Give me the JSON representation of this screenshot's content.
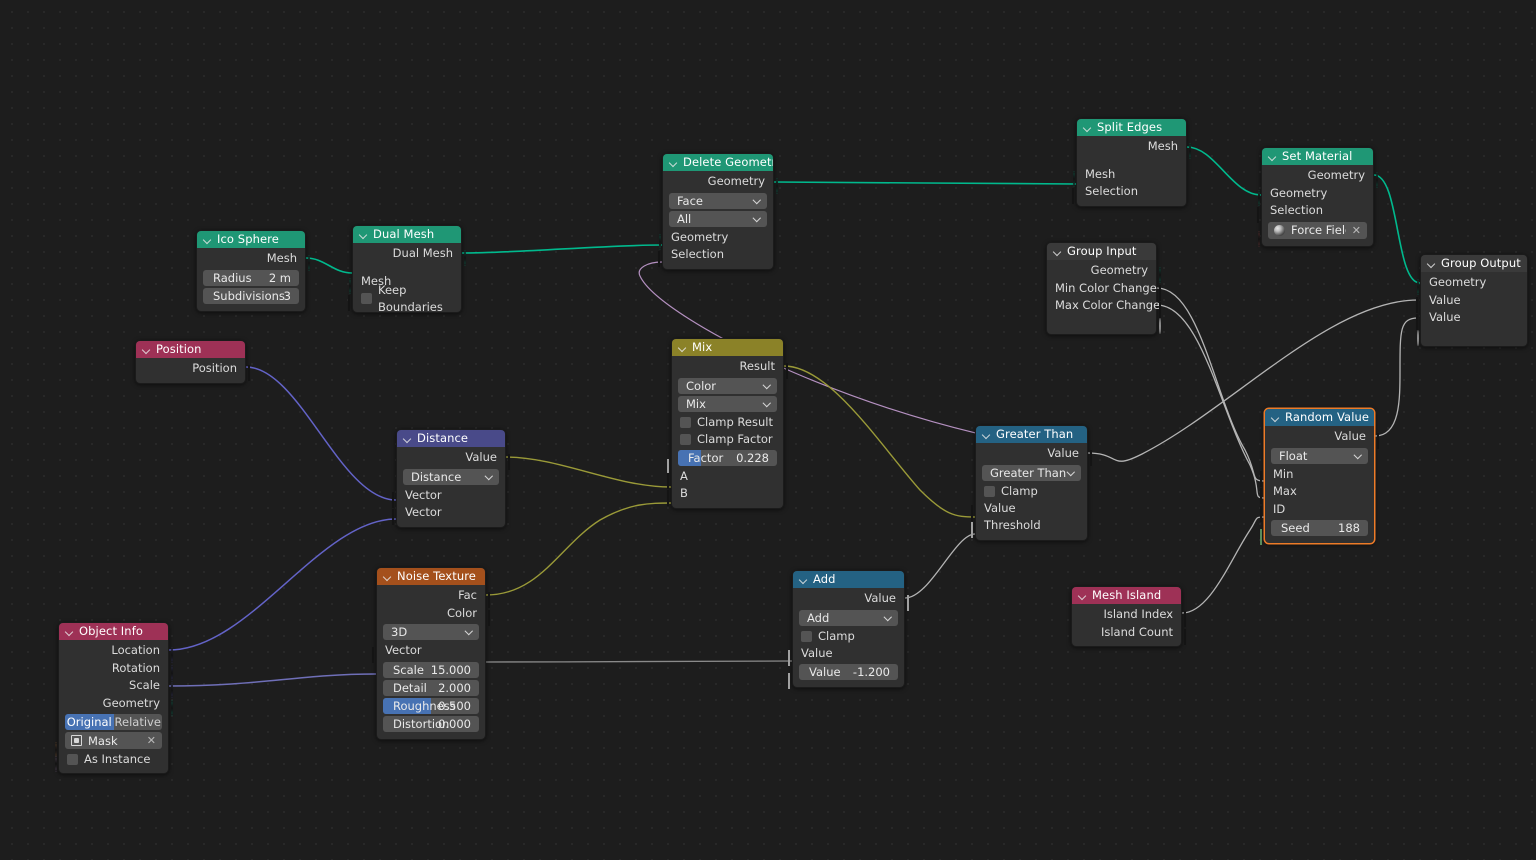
{
  "app": {
    "editor": "Blender Geometry Node Editor",
    "background": "#1d1d1d"
  },
  "palette": {
    "geometry_header": "#1f9775",
    "input_header": "#9e3156",
    "vector_header": "#494a89",
    "converter_header": "#246283",
    "color_header": "#8b8228",
    "texture_header": "#a4501c",
    "group_header": "#3a3a3a",
    "selected_outline": "#ed7b28",
    "socket_geometry": "#00d6a3",
    "socket_vector": "#6363c7",
    "socket_value": "#a1a1a1",
    "socket_color": "#c7c729",
    "socket_boolean": "#cca6d6",
    "socket_integer": "#598c5c",
    "socket_material": "#f06d6d",
    "socket_object": "#ed9e5c"
  },
  "nodes": {
    "ico_sphere": {
      "title": "Ico Sphere",
      "outputs": [
        {
          "label": "Mesh"
        }
      ],
      "inputs": [
        {
          "label": "Radius",
          "value": "2 m"
        },
        {
          "label": "Subdivisions",
          "value": "3"
        }
      ]
    },
    "dual_mesh": {
      "title": "Dual Mesh",
      "outputs": [
        {
          "label": "Dual Mesh"
        }
      ],
      "inputs": [
        {
          "label": "Mesh"
        },
        {
          "label": "Keep Boundaries"
        }
      ]
    },
    "delete_geometry": {
      "title": "Delete Geometry",
      "outputs": [
        {
          "label": "Geometry"
        }
      ],
      "dropdowns": [
        {
          "value": "Face"
        },
        {
          "value": "All"
        }
      ],
      "inputs": [
        {
          "label": "Geometry"
        },
        {
          "label": "Selection"
        }
      ]
    },
    "split_edges": {
      "title": "Split Edges",
      "outputs": [
        {
          "label": "Mesh"
        }
      ],
      "inputs": [
        {
          "label": "Mesh"
        },
        {
          "label": "Selection"
        }
      ]
    },
    "set_material": {
      "title": "Set Material",
      "outputs": [
        {
          "label": "Geometry"
        }
      ],
      "inputs": [
        {
          "label": "Geometry"
        },
        {
          "label": "Selection"
        }
      ],
      "material": {
        "value": "Force Field ...",
        "clear": "✕"
      }
    },
    "group_input": {
      "title": "Group Input",
      "outputs": [
        {
          "label": "Geometry"
        },
        {
          "label": "Min Color Change"
        },
        {
          "label": "Max Color Change"
        },
        {
          "label": ""
        }
      ]
    },
    "group_output": {
      "title": "Group Output",
      "inputs": [
        {
          "label": "Geometry"
        },
        {
          "label": "Value"
        },
        {
          "label": "Value"
        },
        {
          "label": ""
        }
      ]
    },
    "position": {
      "title": "Position",
      "outputs": [
        {
          "label": "Position"
        }
      ]
    },
    "distance": {
      "title": "Distance",
      "outputs": [
        {
          "label": "Value"
        }
      ],
      "dropdowns": [
        {
          "value": "Distance"
        }
      ],
      "inputs": [
        {
          "label": "Vector"
        },
        {
          "label": "Vector"
        }
      ]
    },
    "mix": {
      "title": "Mix",
      "outputs": [
        {
          "label": "Result"
        }
      ],
      "dropdowns": [
        {
          "value": "Color"
        },
        {
          "value": "Mix"
        }
      ],
      "checkboxes": [
        {
          "label": "Clamp Result"
        },
        {
          "label": "Clamp Factor"
        }
      ],
      "slider": {
        "label": "Factor",
        "value": "0.228",
        "fill_pct": 23
      },
      "inputs": [
        {
          "label": "A"
        },
        {
          "label": "B"
        }
      ]
    },
    "noise_texture": {
      "title": "Noise Texture",
      "outputs": [
        {
          "label": "Fac"
        },
        {
          "label": "Color"
        }
      ],
      "dropdowns": [
        {
          "value": "3D"
        }
      ],
      "inputs": [
        {
          "label": "Vector"
        }
      ],
      "fields": [
        {
          "label": "Scale",
          "value": "15.000",
          "fill_pct": 0
        },
        {
          "label": "Detail",
          "value": "2.000",
          "fill_pct": 0
        },
        {
          "label": "Roughness",
          "value": "0.500",
          "fill_pct": 50
        },
        {
          "label": "Distortion",
          "value": "0.000",
          "fill_pct": 0
        }
      ]
    },
    "object_info": {
      "title": "Object Info",
      "outputs": [
        {
          "label": "Location"
        },
        {
          "label": "Rotation"
        },
        {
          "label": "Scale"
        },
        {
          "label": "Geometry"
        }
      ],
      "segmented": {
        "options": [
          "Original",
          "Relative"
        ],
        "selected": "Original"
      },
      "object_field": {
        "value": "Mask",
        "clear": "✕"
      },
      "checkbox": {
        "label": "As Instance"
      }
    },
    "add": {
      "title": "Add",
      "outputs": [
        {
          "label": "Value"
        }
      ],
      "dropdowns": [
        {
          "value": "Add"
        }
      ],
      "checkboxes": [
        {
          "label": "Clamp"
        }
      ],
      "inputs": [
        {
          "label": "Value"
        }
      ],
      "fields": [
        {
          "label": "Value",
          "value": "-1.200"
        }
      ]
    },
    "greater_than": {
      "title": "Greater Than",
      "outputs": [
        {
          "label": "Value"
        }
      ],
      "dropdowns": [
        {
          "value": "Greater Than"
        }
      ],
      "checkboxes": [
        {
          "label": "Clamp"
        }
      ],
      "inputs": [
        {
          "label": "Value"
        },
        {
          "label": "Threshold"
        }
      ]
    },
    "random_value": {
      "title": "Random Value",
      "selected": true,
      "outputs": [
        {
          "label": "Value"
        }
      ],
      "dropdowns": [
        {
          "value": "Float"
        }
      ],
      "inputs": [
        {
          "label": "Min"
        },
        {
          "label": "Max"
        },
        {
          "label": "ID"
        }
      ],
      "fields": [
        {
          "label": "Seed",
          "value": "188"
        }
      ]
    },
    "mesh_island": {
      "title": "Mesh Island",
      "outputs": [
        {
          "label": "Island Index"
        },
        {
          "label": "Island Count"
        }
      ]
    }
  },
  "links": [
    {
      "from": "ico_sphere.Mesh",
      "to": "dual_mesh.Mesh",
      "color": "#00b98d"
    },
    {
      "from": "dual_mesh.Dual Mesh",
      "to": "delete_geometry.Geometry",
      "color": "#00b98d"
    },
    {
      "from": "delete_geometry.Geometry",
      "to": "split_edges.Mesh",
      "color": "#00b98d"
    },
    {
      "from": "split_edges.Mesh",
      "to": "set_material.Geometry",
      "color": "#00b98d"
    },
    {
      "from": "set_material.Geometry",
      "to": "group_output.Geometry",
      "color": "#00b98d"
    },
    {
      "from": "mix.Result",
      "to": "greater_than.Value",
      "color": "#9a9a38"
    },
    {
      "from": "distance.Value",
      "to": "mix.A",
      "color": "#9a9a38"
    },
    {
      "from": "noise_texture.Fac",
      "to": "mix.B",
      "color": "#9a9a38"
    },
    {
      "from": "position.Position",
      "to": "distance.Vector",
      "color": "#6363c7"
    },
    {
      "from": "object_info.Location",
      "to": "distance.Vector",
      "color": "#6363c7"
    },
    {
      "from": "object_info.Scale",
      "to": "noise_texture.Scale",
      "color": "#6f6fb8"
    },
    {
      "from": "noise_texture.Scale",
      "to": "add.Value",
      "color": "#8a8a8a"
    },
    {
      "from": "add.Value",
      "to": "greater_than.Threshold",
      "color": "#b4b4b4"
    },
    {
      "from": "greater_than.Value",
      "to": "group_output.Value",
      "color": "#b4b4b4"
    },
    {
      "from": "group_input.Min Color Change",
      "to": "random_value.Min",
      "color": "#b4b4b4"
    },
    {
      "from": "group_input.Max Color Change",
      "to": "random_value.Max",
      "color": "#b4b4b4"
    },
    {
      "from": "mesh_island.Island Index",
      "to": "random_value.ID",
      "color": "#b4b4b4"
    },
    {
      "from": "random_value.Value",
      "to": "group_output.Value",
      "color": "#b4b4b4"
    },
    {
      "from": "delete_geometry.Selection",
      "to": "greater_than.Value",
      "color": "#b490c0"
    }
  ]
}
